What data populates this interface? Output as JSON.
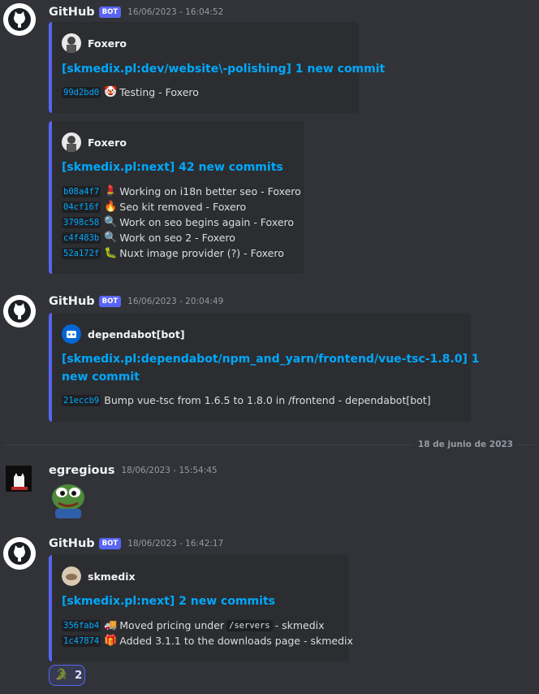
{
  "messages": [
    {
      "author": "GitHub",
      "bot_badge": "BOT",
      "timestamp": "16/06/2023 - 16:04:52",
      "embeds": [
        {
          "author": "Foxero",
          "title": "[skmedix.pl:dev/website\\-polishing] 1 new commit",
          "commits": [
            {
              "hash": "99d2bd0",
              "emoji": "🤡",
              "text": "Testing - Foxero"
            }
          ]
        },
        {
          "author": "Foxero",
          "title": "[skmedix.pl:next] 42 new commits",
          "commits": [
            {
              "hash": "b08a4f7",
              "emoji": "💄",
              "text": "Working on i18n better seo - Foxero"
            },
            {
              "hash": "04cf16f",
              "emoji": "🔥",
              "text": "Seo kit removed - Foxero"
            },
            {
              "hash": "3798c58",
              "emoji": "🔍",
              "text": "Work on seo begins again - Foxero"
            },
            {
              "hash": "c4f483b",
              "emoji": "🔍",
              "text": "Work on seo 2 - Foxero"
            },
            {
              "hash": "52a172f",
              "emoji": "🐛",
              "text": "Nuxt image provider (?) - Foxero"
            }
          ]
        }
      ]
    },
    {
      "author": "GitHub",
      "bot_badge": "BOT",
      "timestamp": "16/06/2023 - 20:04:49",
      "embeds": [
        {
          "author": "dependabot[bot]",
          "title_line1": "[skmedix.pl:dependabot/npm_and_yarn/frontend/vue-tsc-1.8.0] 1",
          "title_line2": "new commit",
          "commits": [
            {
              "hash": "21eccb9",
              "text": "Bump vue-tsc from 1.6.5 to 1.8.0 in /frontend - dependabot[bot]"
            }
          ]
        }
      ]
    },
    {
      "author": "egregious",
      "timestamp": "18/06/2023 - 15:54:45",
      "sticker": "pepe-sticker"
    },
    {
      "author": "GitHub",
      "bot_badge": "BOT",
      "timestamp": "18/06/2023 - 16:42:17",
      "embeds": [
        {
          "author": "skmedix",
          "title": "[skmedix.pl:next] 2 new commits",
          "commits": [
            {
              "hash": "356fab4",
              "emoji": "🚚",
              "text_before": "Moved pricing under",
              "code": "/servers",
              "text_after": "- skmedix"
            },
            {
              "hash": "1c47874",
              "emoji": "🎁",
              "text": "Added 3.1.1 to the downloads page - skmedix"
            }
          ]
        }
      ],
      "reaction": {
        "emoji": "🐊",
        "count": "2"
      }
    }
  ],
  "date_divider": "18 de junio de 2023",
  "colors": {
    "background": "#313338",
    "embed_bg": "#2b2d31",
    "embed_border": "#5865f2",
    "link": "#00a8fc",
    "bot_badge": "#5865f2"
  }
}
